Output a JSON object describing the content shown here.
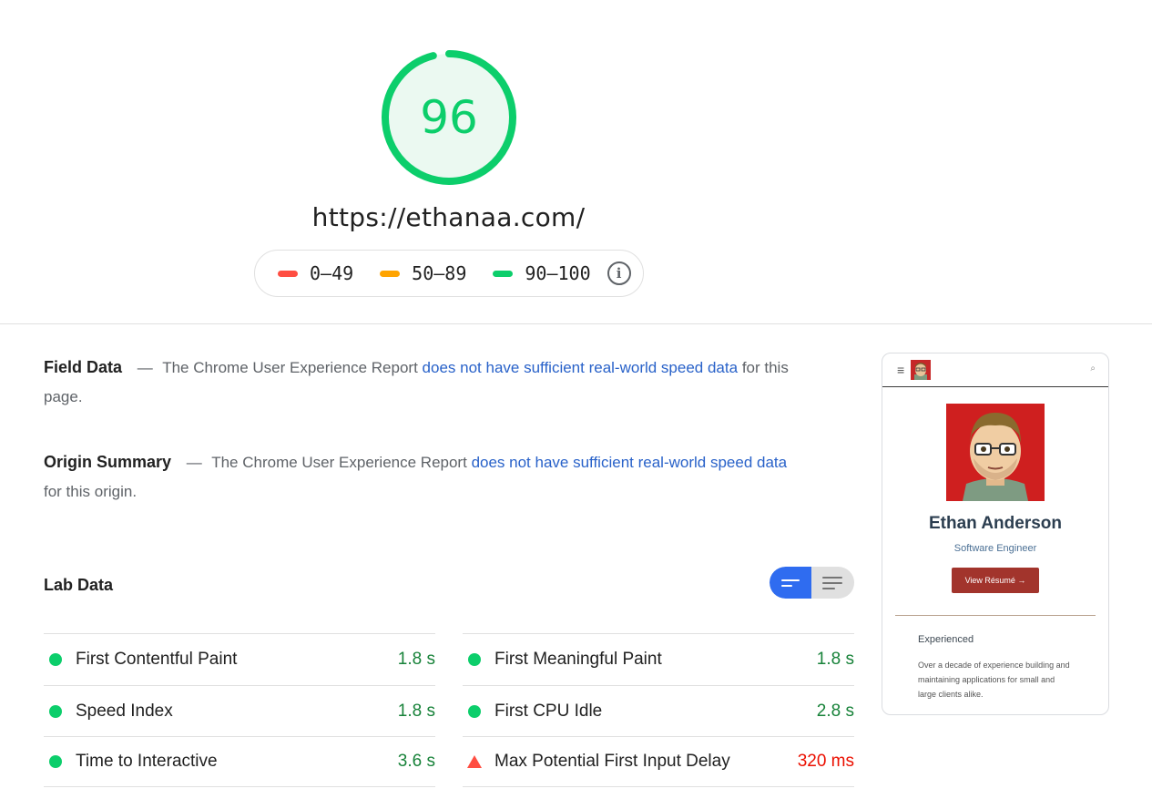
{
  "score": {
    "value": 96,
    "fraction": 0.96,
    "color": "#0cce6b",
    "track_color": "#ebf9f1"
  },
  "url": "https://ethanaa.com/",
  "legend": {
    "items": [
      {
        "label": "0–49",
        "color": "#ff4e42"
      },
      {
        "label": "50–89",
        "color": "#ffa400"
      },
      {
        "label": "90–100",
        "color": "#0cce6b"
      }
    ],
    "info_icon": "info-icon"
  },
  "field_data": {
    "heading": "Field Data",
    "dash": "—",
    "prefix": "The Chrome User Experience Report",
    "link": "does not have sufficient real-world speed data",
    "suffix": "for this page."
  },
  "origin_summary": {
    "heading": "Origin Summary",
    "dash": "—",
    "prefix": "The Chrome User Experience Report",
    "link": "does not have sufficient real-world speed data",
    "suffix": "for this origin."
  },
  "lab_data": {
    "heading": "Lab Data",
    "toggle": {
      "active": "summary-view",
      "options": [
        "summary-view-icon",
        "detail-view-icon"
      ]
    },
    "metrics_left": [
      {
        "label": "First Contentful Paint",
        "value": "1.8 s",
        "status": "pass"
      },
      {
        "label": "Speed Index",
        "value": "1.8 s",
        "status": "pass"
      },
      {
        "label": "Time to Interactive",
        "value": "3.6 s",
        "status": "pass"
      }
    ],
    "metrics_right": [
      {
        "label": "First Meaningful Paint",
        "value": "1.8 s",
        "status": "pass"
      },
      {
        "label": "First CPU Idle",
        "value": "2.8 s",
        "status": "pass"
      },
      {
        "label": "Max Potential First Input Delay",
        "value": "320 ms",
        "status": "fail"
      }
    ]
  },
  "preview": {
    "menu_icon": "≡",
    "search_icon": "⌕",
    "name": "Ethan Anderson",
    "role": "Software Engineer",
    "button": "View Résumé →",
    "subheading": "Experienced",
    "text": "Over a decade of experience building and maintaining applications for small and large clients alike."
  }
}
